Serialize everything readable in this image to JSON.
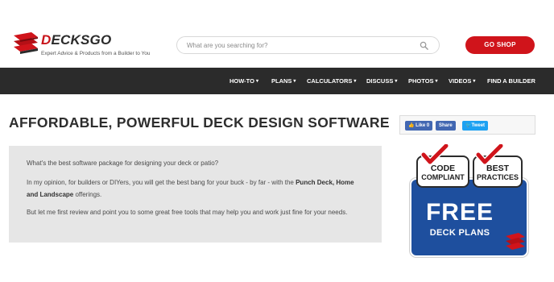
{
  "brand": {
    "name_prefix": "D",
    "name_rest": "ECKSGO",
    "tagline": "Expert Advice & Products from a Builder to You",
    "accent_color": "#d0141b",
    "nav_bg": "#2b2b2b"
  },
  "search": {
    "placeholder": "What are you searching for?",
    "icon": "search-icon"
  },
  "header": {
    "shop_button": "GO SHOP"
  },
  "nav": {
    "items": [
      {
        "label": "HOW-TO",
        "has_dropdown": true
      },
      {
        "label": "PLANS",
        "has_dropdown": true
      },
      {
        "label": "CALCULATORS",
        "has_dropdown": true
      },
      {
        "label": "DISCUSS",
        "has_dropdown": true
      },
      {
        "label": "PHOTOS",
        "has_dropdown": true
      },
      {
        "label": "VIDEOS",
        "has_dropdown": true
      },
      {
        "label": "FIND A BUILDER",
        "has_dropdown": false
      }
    ],
    "chevron": "▾"
  },
  "main": {
    "title": "AFFORDABLE, POWERFUL DECK DESIGN SOFTWARE",
    "paragraph1": "What's the best software package for designing your deck or patio?",
    "paragraph2_start": "In my opinion, for builders or DIYers, you will get the best bang for your buck - by far - with the ",
    "paragraph2_bold": "Punch Deck, Home and Landscape",
    "paragraph2_end": " offerings.",
    "paragraph3": "But let me first review and point you to some great free tools that may help you and work just fine for your needs."
  },
  "share": {
    "like": "Like 0",
    "share": "Share",
    "tweet": "Tweet"
  },
  "ad": {
    "badge1_line1": "CODE",
    "badge1_line2": "COMPLIANT",
    "badge2_line1": "BEST",
    "badge2_line2": "PRACTICES",
    "headline": "FREE",
    "subline": "DECK PLANS",
    "blue": "#1e4f9e",
    "check_red": "#d0141b"
  }
}
